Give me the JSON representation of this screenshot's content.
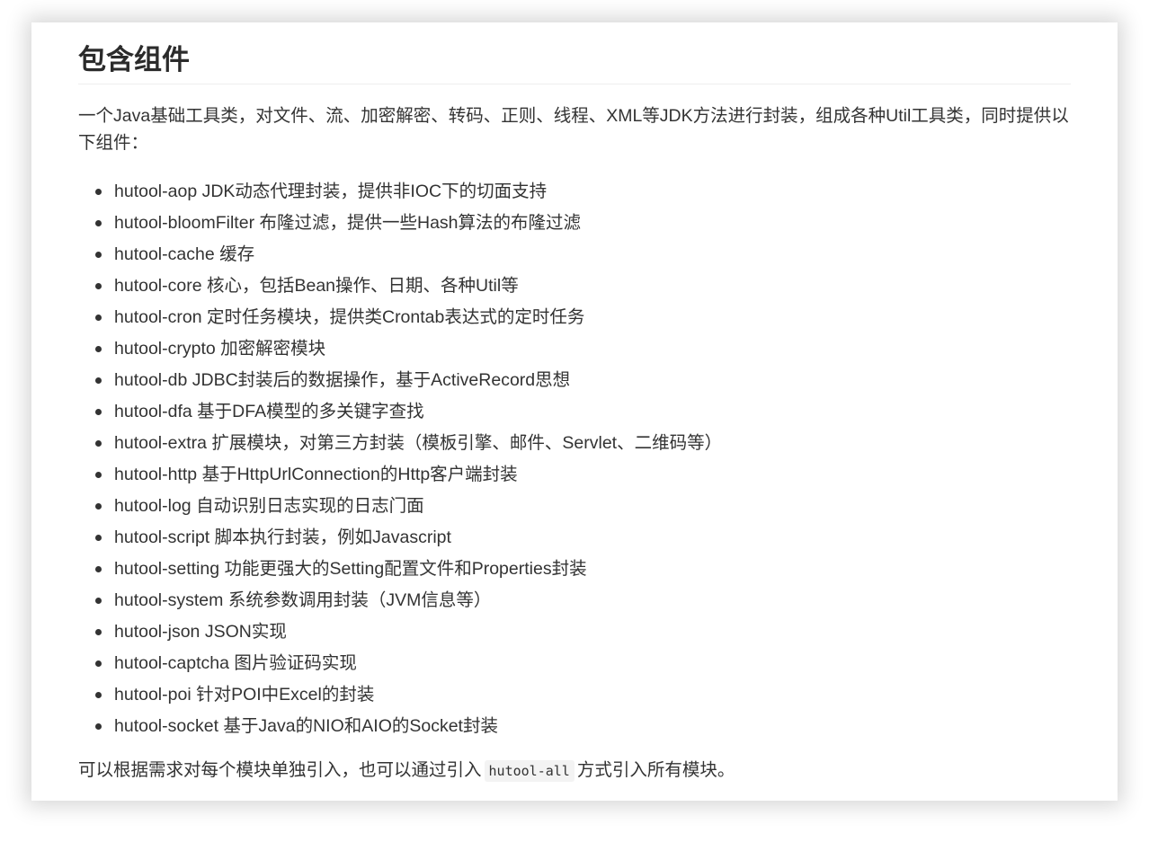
{
  "section": {
    "title": "包含组件",
    "intro": "一个Java基础工具类，对文件、流、加密解密、转码、正则、线程、XML等JDK方法进行封装，组成各种Util工具类，同时提供以下组件：",
    "modules": [
      {
        "name": "hutool-aop",
        "desc": "JDK动态代理封装，提供非IOC下的切面支持"
      },
      {
        "name": "hutool-bloomFilter",
        "desc": "布隆过滤，提供一些Hash算法的布隆过滤"
      },
      {
        "name": "hutool-cache",
        "desc": "缓存"
      },
      {
        "name": "hutool-core",
        "desc": "核心，包括Bean操作、日期、各种Util等"
      },
      {
        "name": "hutool-cron",
        "desc": "定时任务模块，提供类Crontab表达式的定时任务"
      },
      {
        "name": "hutool-crypto",
        "desc": "加密解密模块"
      },
      {
        "name": "hutool-db",
        "desc": "JDBC封装后的数据操作，基于ActiveRecord思想"
      },
      {
        "name": "hutool-dfa",
        "desc": "基于DFA模型的多关键字查找"
      },
      {
        "name": "hutool-extra",
        "desc": "扩展模块，对第三方封装（模板引擎、邮件、Servlet、二维码等）"
      },
      {
        "name": "hutool-http",
        "desc": "基于HttpUrlConnection的Http客户端封装"
      },
      {
        "name": "hutool-log",
        "desc": "自动识别日志实现的日志门面"
      },
      {
        "name": "hutool-script",
        "desc": "脚本执行封装，例如Javascript"
      },
      {
        "name": "hutool-setting",
        "desc": "功能更强大的Setting配置文件和Properties封装"
      },
      {
        "name": "hutool-system",
        "desc": "系统参数调用封装（JVM信息等）"
      },
      {
        "name": "hutool-json",
        "desc": "JSON实现"
      },
      {
        "name": "hutool-captcha",
        "desc": "图片验证码实现"
      },
      {
        "name": "hutool-poi",
        "desc": "针对POI中Excel的封装"
      },
      {
        "name": "hutool-socket",
        "desc": "基于Java的NIO和AIO的Socket封装"
      }
    ],
    "footer": {
      "before": "可以根据需求对每个模块单独引入，也可以通过引入",
      "code": "hutool-all",
      "after": "方式引入所有模块。"
    }
  }
}
